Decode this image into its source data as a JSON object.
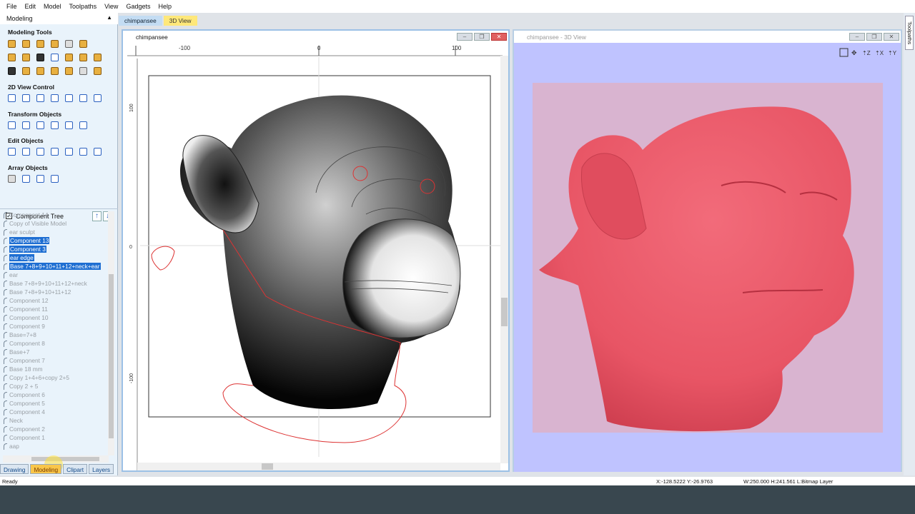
{
  "menu": [
    "File",
    "Edit",
    "Model",
    "Toolpaths",
    "View",
    "Gadgets",
    "Help"
  ],
  "left_panel": {
    "title": "Modeling",
    "sections": {
      "modeling_tools": "Modeling Tools",
      "view_control": "2D View Control",
      "transform": "Transform Objects",
      "edit": "Edit Objects",
      "array": "Array Objects"
    },
    "component_tree_label": "Component Tree"
  },
  "tree_items": [
    {
      "label": "Component 14",
      "selected": false
    },
    {
      "label": "Copy of Visible Model",
      "selected": false
    },
    {
      "label": "ear sculpt",
      "selected": false
    },
    {
      "label": "Component 13",
      "selected": true
    },
    {
      "label": "Component 3",
      "selected": true
    },
    {
      "label": "ear edge",
      "selected": true
    },
    {
      "label": "Base 7+8+9+10+11+12+neck+ear",
      "selected": true
    },
    {
      "label": "ear",
      "selected": false
    },
    {
      "label": "Base 7+8+9+10+11+12+neck",
      "selected": false
    },
    {
      "label": "Base 7+8+9+10+11+12",
      "selected": false
    },
    {
      "label": "Component 12",
      "selected": false
    },
    {
      "label": "Component 11",
      "selected": false
    },
    {
      "label": "Component 10",
      "selected": false
    },
    {
      "label": "Component 9",
      "selected": false
    },
    {
      "label": "Base=7+8",
      "selected": false
    },
    {
      "label": "Component 8",
      "selected": false
    },
    {
      "label": "Base+7",
      "selected": false
    },
    {
      "label": "Component 7",
      "selected": false
    },
    {
      "label": "Base 18 mm",
      "selected": false
    },
    {
      "label": "Copy 1+4+6+copy 2+5",
      "selected": false
    },
    {
      "label": "Copy 2 + 5",
      "selected": false
    },
    {
      "label": "Component 6",
      "selected": false
    },
    {
      "label": "Component 5",
      "selected": false
    },
    {
      "label": "Component 4",
      "selected": false
    },
    {
      "label": "Neck",
      "selected": false
    },
    {
      "label": "Component 2",
      "selected": false
    },
    {
      "label": "Component 1",
      "selected": false
    },
    {
      "label": "aap",
      "selected": false
    }
  ],
  "bottom_tabs": [
    "Drawing",
    "Modeling",
    "Clipart",
    "Layers"
  ],
  "doc_tabs": [
    "chimpansee",
    "3D View"
  ],
  "view2d": {
    "title": "chimpansee",
    "ruler_top": [
      "-100",
      "0",
      "100"
    ],
    "ruler_left": [
      "100",
      "0",
      "-100"
    ]
  },
  "view3d": {
    "title": "chimpansee - 3D View"
  },
  "toolpaths_tab": "Toolpaths",
  "status": {
    "ready": "Ready",
    "coords": "X:-128.5222 Y:-26.9763",
    "size": "W:250.000  H:241.561  L:Bitmap Layer"
  },
  "colors": {
    "model": "#ef5b6b",
    "bg3d": "#bfc3ff",
    "accent": "#1e6ed2"
  }
}
